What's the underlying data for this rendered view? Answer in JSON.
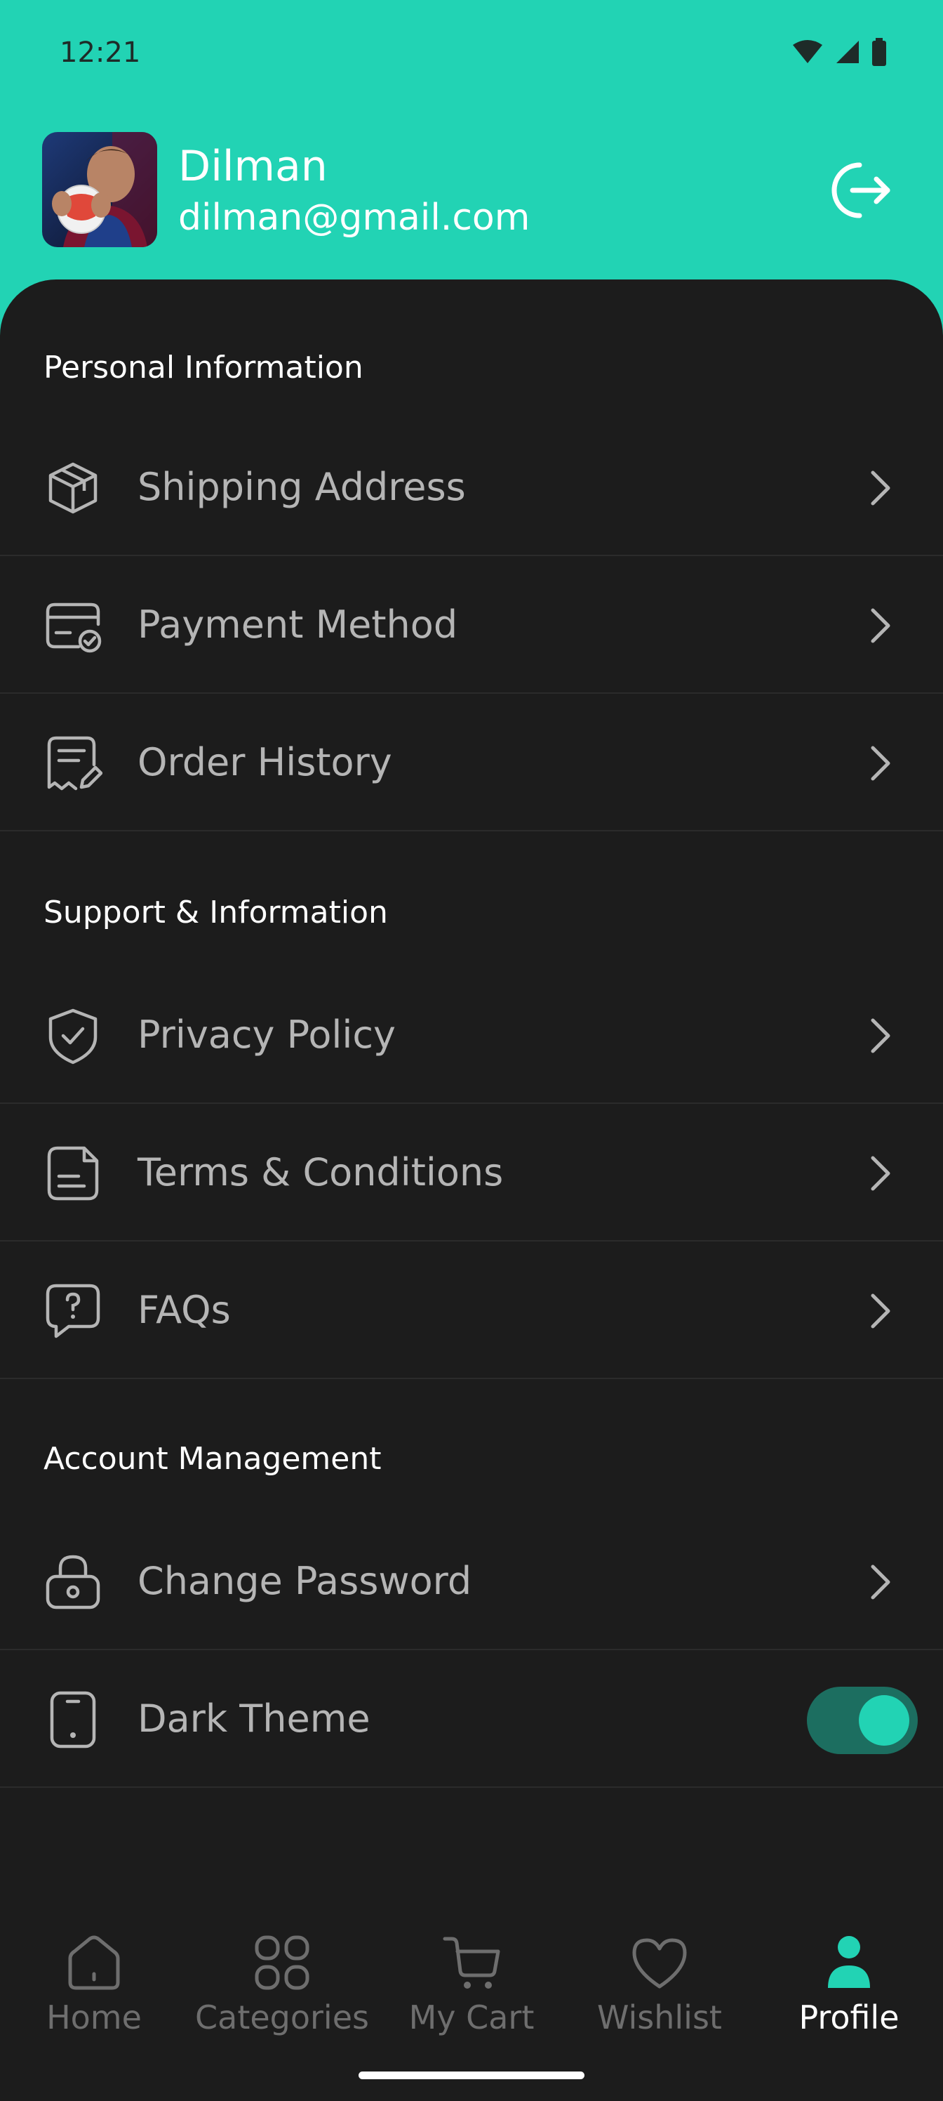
{
  "status_bar": {
    "time": "12:21"
  },
  "header": {
    "user_name": "Dilman",
    "user_email": "dilman@gmail.com",
    "avatar_icon": "avatar-photo",
    "logout_icon": "logout-icon"
  },
  "sections": [
    {
      "title": "Personal Information",
      "items": [
        {
          "label": "Shipping Address",
          "icon": "package-icon"
        },
        {
          "label": "Payment Method",
          "icon": "credit-card-icon"
        },
        {
          "label": "Order History",
          "icon": "receipt-edit-icon"
        }
      ]
    },
    {
      "title": "Support & Information",
      "items": [
        {
          "label": "Privacy Policy",
          "icon": "shield-check-icon"
        },
        {
          "label": "Terms & Conditions",
          "icon": "document-icon"
        },
        {
          "label": "FAQs",
          "icon": "question-bubble-icon"
        }
      ]
    },
    {
      "title": "Account Management",
      "items": [
        {
          "label": "Change Password",
          "icon": "lock-icon"
        },
        {
          "label": "Dark Theme",
          "icon": "phone-icon",
          "toggle": true
        }
      ]
    }
  ],
  "bottom_nav": [
    {
      "label": "Home",
      "icon": "home-icon",
      "active": false
    },
    {
      "label": "Categories",
      "icon": "grid-icon",
      "active": false
    },
    {
      "label": "My Cart",
      "icon": "cart-icon",
      "active": false
    },
    {
      "label": "Wishlist",
      "icon": "heart-icon",
      "active": false
    },
    {
      "label": "Profile",
      "icon": "person-icon",
      "active": true
    }
  ],
  "colors": {
    "accent": "#22d3b4",
    "background": "#1c1c1c",
    "toggle_track": "#1c6e60"
  },
  "toggles": {
    "dark_theme": true
  }
}
